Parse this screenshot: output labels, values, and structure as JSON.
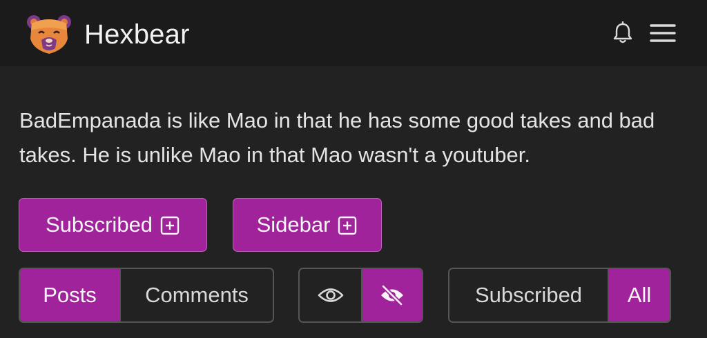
{
  "app": {
    "name": "Hexbear"
  },
  "community": {
    "description": "BadEmpanada is like Mao in that he has some good takes and bad takes. He is unlike Mao in that Mao wasn't a youtuber."
  },
  "actions": {
    "subscribed_label": "Subscribed",
    "sidebar_label": "Sidebar"
  },
  "view_toggle": {
    "posts_label": "Posts",
    "comments_label": "Comments",
    "active": "Posts"
  },
  "visibility_toggle": {
    "show_icon": "eye-icon",
    "hide_icon": "eye-slash-icon",
    "active": "hide"
  },
  "listing_toggle": {
    "subscribed_label": "Subscribed",
    "all_label": "All",
    "active": "All"
  },
  "colors": {
    "accent": "#a1239b",
    "background": "#222222",
    "navbar": "#1b1b1b"
  }
}
